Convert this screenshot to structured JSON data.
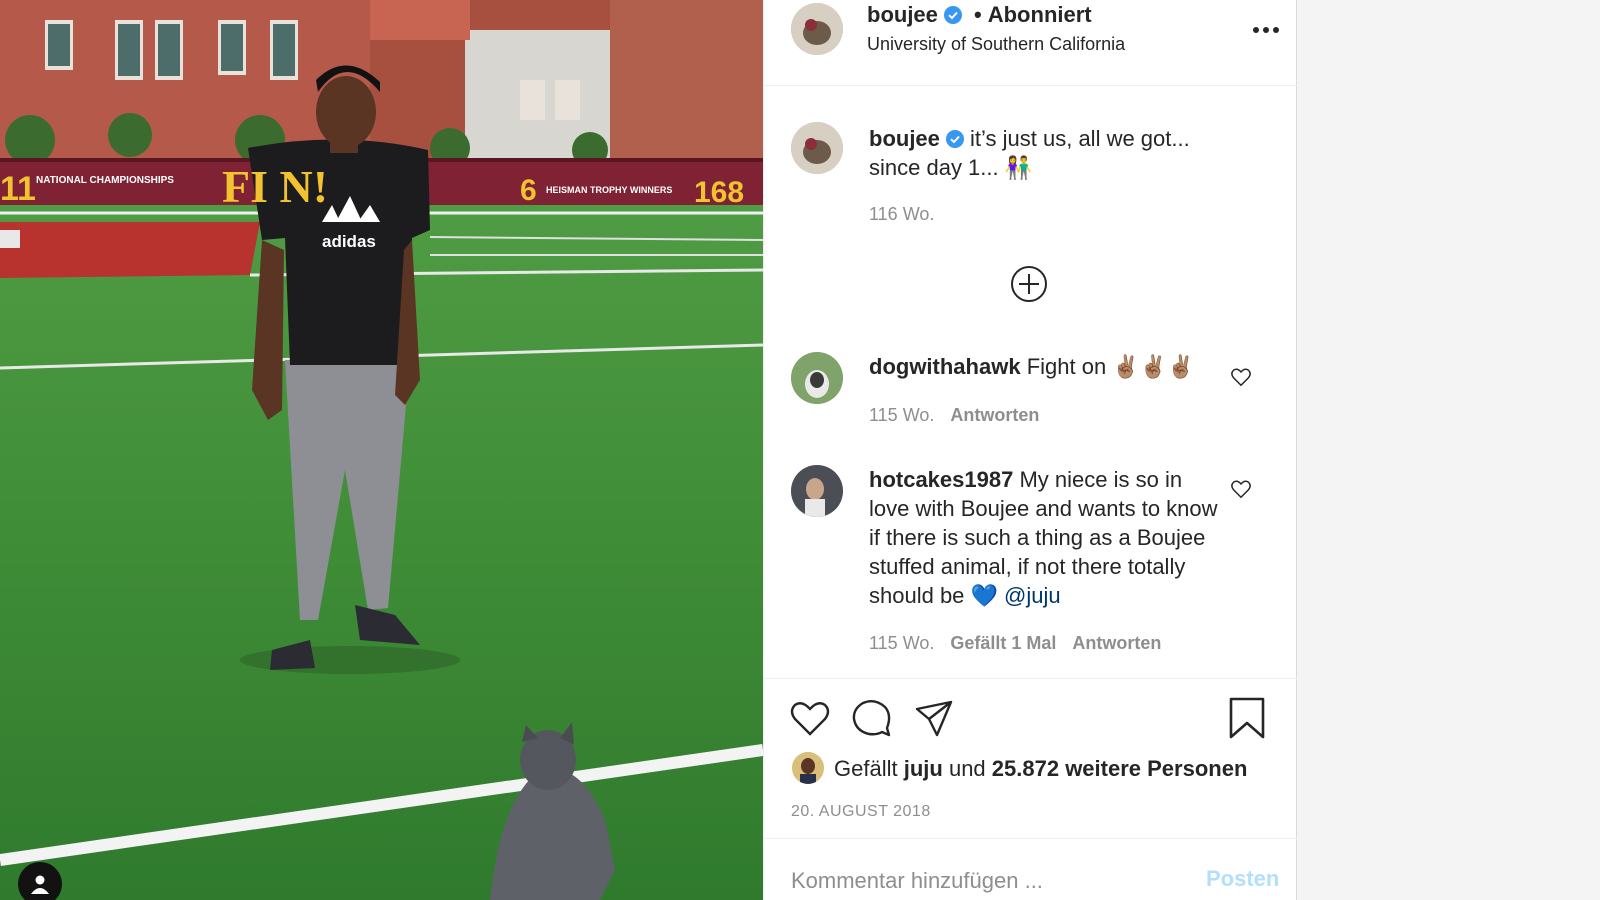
{
  "photo": {
    "banner_left": "11",
    "banner_left_caption": "NATIONAL CHAMPIONSHIPS",
    "banner_mid": "FI   N!",
    "banner_heisman": "6",
    "banner_heisman_caption": "HEISMAN TROPHY WINNERS",
    "banner_right": "168",
    "shirt_brand": "adidas"
  },
  "header": {
    "username": "boujee",
    "separator": "•",
    "follow_status": "Abonniert",
    "location": "University of Southern California"
  },
  "caption": {
    "username": "boujee",
    "text": "it’s just us, all we got... since day 1... 👫",
    "time": "116 Wo."
  },
  "comments": [
    {
      "username": "dogwithahawk",
      "text": "Fight on ✌🏽✌🏽✌🏽",
      "time": "115 Wo.",
      "reply": "Antworten"
    },
    {
      "username": "hotcakes1987",
      "text": "My niece is so in love with Boujee and wants to know if there is such a thing as a Boujee stuffed animal, if not there totally should be 💙 ",
      "mention": "@juju",
      "time": "115 Wo.",
      "likes": "Gefällt 1 Mal",
      "reply": "Antworten"
    }
  ],
  "likes": {
    "prefix": "Gefällt",
    "user": "juju",
    "middle": "und",
    "count": "25.872 weitere Personen"
  },
  "date": "20. AUGUST 2018",
  "comment_box": {
    "placeholder": "Kommentar hinzufügen ...",
    "post_label": "Posten"
  },
  "colors": {
    "verified": "#3897f0",
    "post_disabled": "#b2dffc",
    "muted": "#8e8e8e",
    "text": "#262626"
  },
  "icons": [
    "more-icon",
    "verified-icon",
    "load-more-icon",
    "heart-icon",
    "comment-icon",
    "share-icon",
    "bookmark-icon",
    "user-tag-icon"
  ]
}
